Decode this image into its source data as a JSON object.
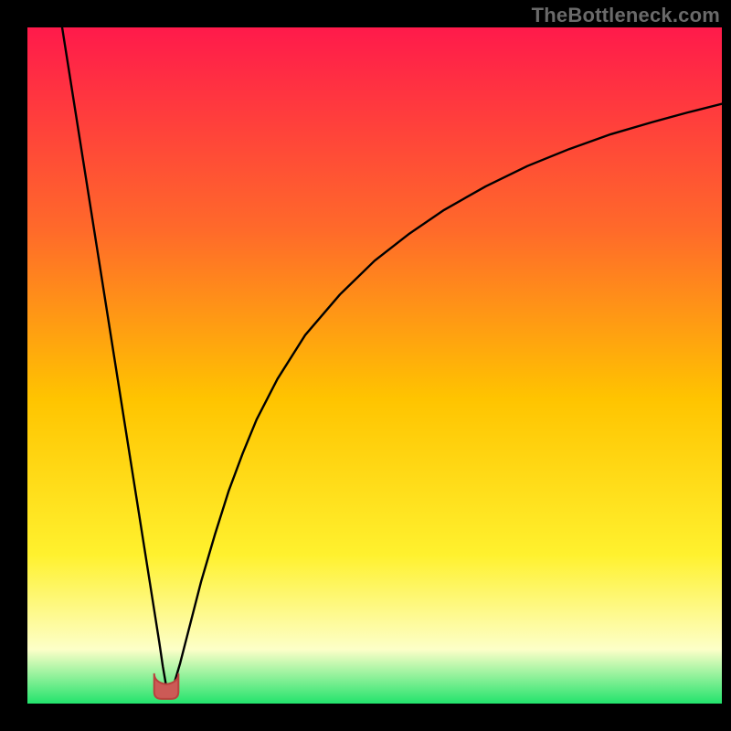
{
  "watermark": "TheBottleneck.com",
  "colors": {
    "frame": "#000000",
    "gradient_top": "#ff1a4b",
    "gradient_mid_upper": "#ff6a2a",
    "gradient_mid": "#ffc400",
    "gradient_mid_lower": "#fff12e",
    "gradient_pale": "#fdffc8",
    "gradient_bottom": "#22e36c",
    "curve": "#000000",
    "marker_fill": "#cc5a56",
    "marker_stroke": "#b9423e"
  },
  "chart_data": {
    "type": "line",
    "title": "",
    "xlabel": "",
    "ylabel": "",
    "xlim": [
      0,
      100
    ],
    "ylim": [
      0,
      100
    ],
    "x": [
      5,
      6,
      7,
      8,
      9,
      10,
      11,
      12,
      13,
      14,
      15,
      16,
      17,
      18,
      19,
      19.5,
      20,
      20.5,
      21,
      22,
      23,
      24,
      25,
      27,
      29,
      31,
      33,
      36,
      40,
      45,
      50,
      55,
      60,
      66,
      72,
      78,
      84,
      90,
      95,
      100
    ],
    "values": [
      100,
      93.5,
      87,
      80.5,
      74,
      67.5,
      61,
      54.5,
      48,
      41.5,
      35,
      28.5,
      22,
      15.5,
      9,
      5.5,
      2.5,
      1,
      2.5,
      6,
      10,
      14,
      18,
      25,
      31.5,
      37,
      42,
      48,
      54.5,
      60.5,
      65.5,
      69.5,
      73,
      76.5,
      79.5,
      82,
      84.2,
      86,
      87.4,
      88.7
    ],
    "marker": {
      "x": 20,
      "y": 1.5,
      "width": 3.5
    }
  }
}
